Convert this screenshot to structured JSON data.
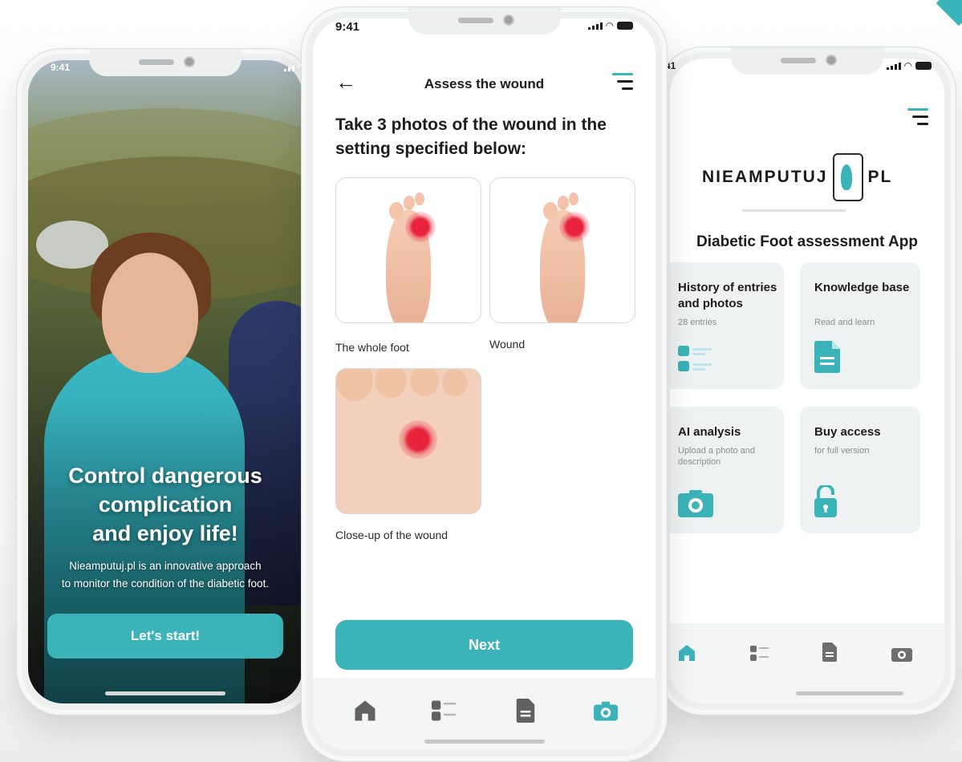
{
  "status": {
    "time": "9:41",
    "time_cut": "41"
  },
  "phone1": {
    "hero_line1": "Control dangerous",
    "hero_line2": "complication",
    "hero_line3": "and enjoy life!",
    "sub_line1": "Nieamputuj.pl is an innovative approach",
    "sub_line2": "to monitor the condition of the diabetic foot.",
    "start_label": "Let's start!"
  },
  "phone2": {
    "title": "Assess the wound",
    "heading": "Take 3 photos of the wound in the setting specified below:",
    "cards": [
      {
        "label": "The whole foot"
      },
      {
        "label": "Wound"
      },
      {
        "label": "Close-up of the wound"
      }
    ],
    "next_label": "Next",
    "tabs": [
      "home-icon",
      "list-icon",
      "document-icon",
      "camera-icon"
    ]
  },
  "phone3": {
    "logo_left": "NIEAMPUTUJ",
    "logo_right": "PL",
    "app_title": "Diabetic Foot assessment App",
    "tiles": [
      {
        "title": "History of entries and photos",
        "sub": "28 entries"
      },
      {
        "title": "Knowledge base",
        "sub": "Read and learn"
      },
      {
        "title": "AI analysis",
        "sub": "Upload a photo and description"
      },
      {
        "title": "Buy access",
        "sub": "for full version"
      }
    ]
  },
  "colors": {
    "accent": "#3ab3b9",
    "text": "#1d1d1f",
    "tile_bg": "#eef2f3"
  }
}
